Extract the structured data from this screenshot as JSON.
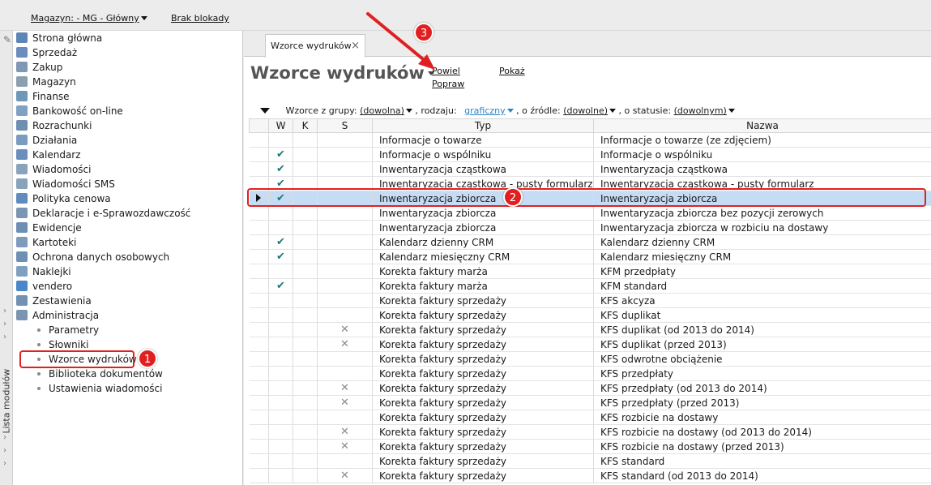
{
  "topbar": {
    "warehouse": "Magazyn: - MG - Główny",
    "lock": "Brak blokady"
  },
  "left_strip": {
    "label": "Lista modułów"
  },
  "sidebar": {
    "items": [
      {
        "label": "Strona główna",
        "icon": "home-icon",
        "color": "#5c86b8"
      },
      {
        "label": "Sprzedaż",
        "icon": "sales-icon",
        "color": "#6b8cc0"
      },
      {
        "label": "Zakup",
        "icon": "cart-icon",
        "color": "#7e98b6"
      },
      {
        "label": "Magazyn",
        "icon": "warehouse-icon",
        "color": "#8aa0b0"
      },
      {
        "label": "Finanse",
        "icon": "finance-icon",
        "color": "#6f98b8"
      },
      {
        "label": "Bankowość on-line",
        "icon": "bank-icon",
        "color": "#7fa2c4"
      },
      {
        "label": "Rozrachunki",
        "icon": "settlement-icon",
        "color": "#6e8fb2"
      },
      {
        "label": "Działania",
        "icon": "actions-icon",
        "color": "#7a9cc0"
      },
      {
        "label": "Kalendarz",
        "icon": "calendar-icon",
        "color": "#6a8fbf"
      },
      {
        "label": "Wiadomości",
        "icon": "message-icon",
        "color": "#8aa3bd"
      },
      {
        "label": "Wiadomości SMS",
        "icon": "sms-icon",
        "color": "#8aa3bd"
      },
      {
        "label": "Polityka cenowa",
        "icon": "price-icon",
        "color": "#5f8bbf"
      },
      {
        "label": "Deklaracje i e-Sprawozdawczość",
        "icon": "declaration-icon",
        "color": "#7b96b4"
      },
      {
        "label": "Ewidencje",
        "icon": "records-icon",
        "color": "#6d8fb4"
      },
      {
        "label": "Kartoteki",
        "icon": "cards-icon",
        "color": "#7d9bbd"
      },
      {
        "label": "Ochrona danych osobowych",
        "icon": "shield-icon",
        "color": "#6f90b6"
      },
      {
        "label": "Naklejki",
        "icon": "sticker-icon",
        "color": "#7fa0c0"
      },
      {
        "label": "vendero",
        "icon": "vendero-icon",
        "color": "#4a86c8"
      },
      {
        "label": "Zestawienia",
        "icon": "report-icon",
        "color": "#7291b4"
      },
      {
        "label": "Administracja",
        "icon": "admin-icon",
        "color": "#7b95b0"
      }
    ],
    "subitems": [
      {
        "label": "Parametry"
      },
      {
        "label": "Słowniki"
      },
      {
        "label": "Wzorce wydruków"
      },
      {
        "label": "Biblioteka dokumentów"
      },
      {
        "label": "Ustawienia wiadomości"
      }
    ]
  },
  "main": {
    "tab": {
      "label": "Wzorce wydruków",
      "close": "×"
    },
    "title": "Wzorce wydruków",
    "actions": {
      "duplicate": "Powiel",
      "edit": "Popraw",
      "show": "Pokaż"
    },
    "filter": {
      "prefix": "Wzorce z grupy:",
      "group": "(dowolna)",
      "kind_label": ", rodzaju:",
      "kind": "graficzny",
      "source_label": ", o źródle:",
      "source": "(dowolne)",
      "status_label": ", o statusie:",
      "status": "(dowolnym)"
    },
    "columns": {
      "w": "W",
      "k": "K",
      "s": "S",
      "typ": "Typ",
      "nazwa": "Nazwa"
    },
    "rows": [
      {
        "w": "",
        "s": "",
        "typ": "Informacje o towarze",
        "nazwa": "Informacje o towarze (ze zdjęciem)"
      },
      {
        "w": "✔",
        "s": "",
        "typ": "Informacje o wspólniku",
        "nazwa": "Informacje o wspólniku"
      },
      {
        "w": "✔",
        "s": "",
        "typ": "Inwentaryzacja cząstkowa",
        "nazwa": "Inwentaryzacja cząstkowa"
      },
      {
        "w": "✔",
        "s": "",
        "typ": "Inwentaryzacja cząstkowa - pusty formularz",
        "nazwa": "Inwentaryzacja cząstkowa - pusty formularz"
      },
      {
        "w": "✔",
        "s": "",
        "typ": "Inwentaryzacja zbiorcza",
        "nazwa": "Inwentaryzacja zbiorcza",
        "selected": true
      },
      {
        "w": "",
        "s": "",
        "typ": "Inwentaryzacja zbiorcza",
        "nazwa": "Inwentaryzacja zbiorcza bez pozycji zerowych"
      },
      {
        "w": "",
        "s": "",
        "typ": "Inwentaryzacja zbiorcza",
        "nazwa": "Inwentaryzacja zbiorcza w rozbiciu na dostawy"
      },
      {
        "w": "✔",
        "s": "",
        "typ": "Kalendarz dzienny CRM",
        "nazwa": "Kalendarz dzienny CRM"
      },
      {
        "w": "✔",
        "s": "",
        "typ": "Kalendarz miesięczny CRM",
        "nazwa": "Kalendarz miesięczny CRM"
      },
      {
        "w": "",
        "s": "",
        "typ": "Korekta faktury marża",
        "nazwa": "KFM przedpłaty"
      },
      {
        "w": "✔",
        "s": "",
        "typ": "Korekta faktury marża",
        "nazwa": "KFM standard"
      },
      {
        "w": "",
        "s": "",
        "typ": "Korekta faktury sprzedaży",
        "nazwa": "KFS akcyza"
      },
      {
        "w": "",
        "s": "",
        "typ": "Korekta faktury sprzedaży",
        "nazwa": "KFS duplikat"
      },
      {
        "w": "",
        "s": "✕",
        "typ": "Korekta faktury sprzedaży",
        "nazwa": "KFS duplikat (od 2013 do 2014)"
      },
      {
        "w": "",
        "s": "✕",
        "typ": "Korekta faktury sprzedaży",
        "nazwa": "KFS duplikat (przed 2013)"
      },
      {
        "w": "",
        "s": "",
        "typ": "Korekta faktury sprzedaży",
        "nazwa": "KFS odwrotne obciążenie"
      },
      {
        "w": "",
        "s": "",
        "typ": "Korekta faktury sprzedaży",
        "nazwa": "KFS przedpłaty"
      },
      {
        "w": "",
        "s": "✕",
        "typ": "Korekta faktury sprzedaży",
        "nazwa": "KFS przedpłaty (od 2013 do 2014)"
      },
      {
        "w": "",
        "s": "✕",
        "typ": "Korekta faktury sprzedaży",
        "nazwa": "KFS przedpłaty (przed 2013)"
      },
      {
        "w": "",
        "s": "",
        "typ": "Korekta faktury sprzedaży",
        "nazwa": "KFS rozbicie na dostawy"
      },
      {
        "w": "",
        "s": "✕",
        "typ": "Korekta faktury sprzedaży",
        "nazwa": "KFS rozbicie na dostawy (od 2013 do 2014)"
      },
      {
        "w": "",
        "s": "✕",
        "typ": "Korekta faktury sprzedaży",
        "nazwa": "KFS rozbicie na dostawy (przed 2013)"
      },
      {
        "w": "",
        "s": "",
        "typ": "Korekta faktury sprzedaży",
        "nazwa": "KFS standard"
      },
      {
        "w": "",
        "s": "✕",
        "typ": "Korekta faktury sprzedaży",
        "nazwa": "KFS standard (od 2013 do 2014)"
      }
    ]
  },
  "annotations": {
    "b1": "1",
    "b2": "2",
    "b3": "3",
    "color": "#e02020"
  }
}
